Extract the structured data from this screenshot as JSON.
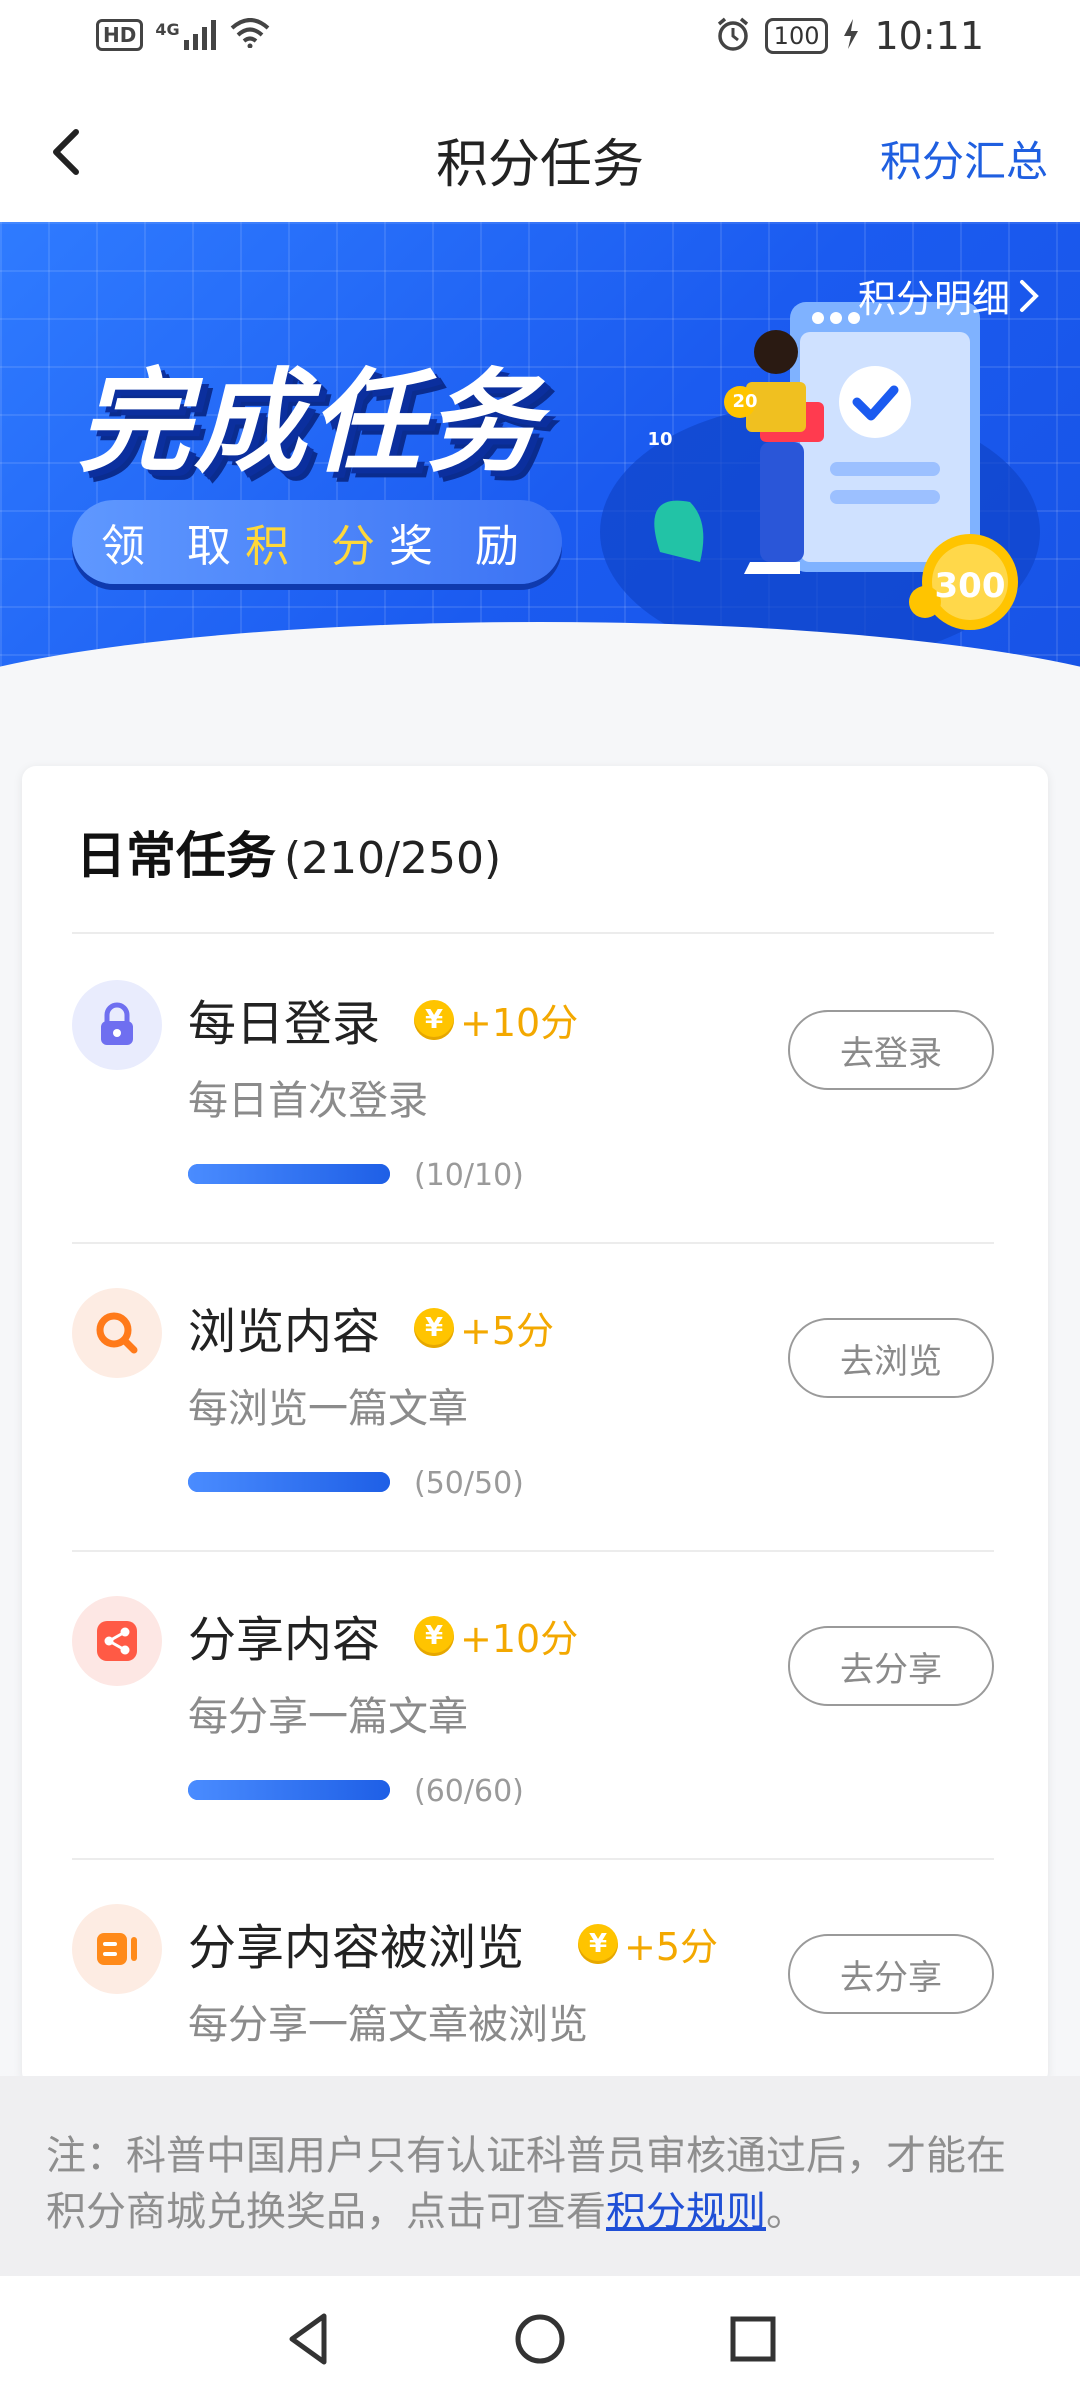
{
  "status_bar": {
    "hd": "HD",
    "network": "4G",
    "battery": "100",
    "time": "10:11"
  },
  "nav": {
    "title": "积分任务",
    "right_link": "积分汇总"
  },
  "banner": {
    "detail_link": "积分明细",
    "headline": "完成任务",
    "tagline_pre": "领 取 ",
    "tagline_highlight": "积 分",
    "tagline_post": " 奖 励",
    "coin_labels": [
      "20",
      "10",
      "300"
    ]
  },
  "daily": {
    "title": "日常任务",
    "progress": "(210/250)",
    "tasks": [
      {
        "name": "每日登录",
        "points": "+10分",
        "desc": "每日首次登录",
        "progress_text": "(10/10)",
        "progress": 1.0,
        "button": "去登录",
        "icon": "lock-icon"
      },
      {
        "name": "浏览内容",
        "points": "+5分",
        "desc": "每浏览一篇文章",
        "progress_text": "(50/50)",
        "progress": 1.0,
        "button": "去浏览",
        "icon": "search-icon"
      },
      {
        "name": "分享内容",
        "points": "+10分",
        "desc": "每分享一篇文章",
        "progress_text": "(60/60)",
        "progress": 1.0,
        "button": "去分享",
        "icon": "share-icon"
      },
      {
        "name": "分享内容被浏览",
        "points": "+5分",
        "desc": "每分享一篇文章被浏览",
        "progress_text": "",
        "progress": null,
        "button": "去分享",
        "icon": "video-icon"
      }
    ]
  },
  "note": {
    "text": "注：科普中国用户只有认证科普员审核通过后，才能在积分商城兑换奖品，点击可查看",
    "link": "积分规则",
    "end": "。"
  },
  "coin_symbol": "¥",
  "colors": {
    "accent": "#1f5fe0",
    "points": "#f3a800",
    "banner": "#1b5bf0"
  }
}
